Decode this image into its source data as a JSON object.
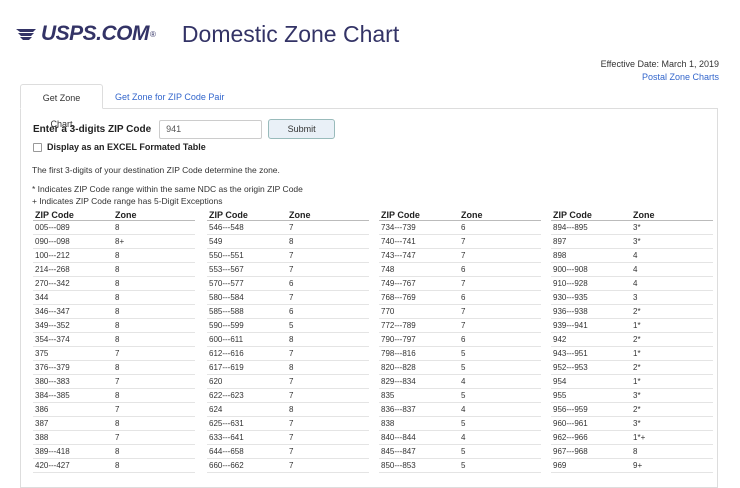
{
  "header": {
    "logo_text": "USPS.COM",
    "logo_mark": "®",
    "title": "Domestic Zone Chart",
    "brand_color": "#333366"
  },
  "effective_date": "Effective Date: March 1, 2019",
  "postal_zone_charts_link": "Postal Zone Charts",
  "tabs": [
    {
      "label": "Get Zone Chart",
      "active": true
    },
    {
      "label": "Get Zone for ZIP Code Pair",
      "active": false
    }
  ],
  "form": {
    "zip_label": "Enter a 3-digits ZIP Code",
    "zip_value": "941",
    "submit_label": "Submit",
    "excel_checkbox_label": "Display as an EXCEL Formated Table",
    "excel_checked": false
  },
  "info": {
    "line1": "The first 3-digits of your destination ZIP Code determine the zone.",
    "line2": "* Indicates ZIP Code range within the same NDC as the origin ZIP Code",
    "line3": "+ Indicates ZIP Code range has 5-Digit Exceptions"
  },
  "table_headers": {
    "zip": "ZIP Code",
    "zone": "Zone"
  },
  "columns": [
    [
      [
        "005---089",
        "8"
      ],
      [
        "090---098",
        "8+"
      ],
      [
        "100---212",
        "8"
      ],
      [
        "214---268",
        "8"
      ],
      [
        "270---342",
        "8"
      ],
      [
        "344",
        "8"
      ],
      [
        "346---347",
        "8"
      ],
      [
        "349---352",
        "8"
      ],
      [
        "354---374",
        "8"
      ],
      [
        "375",
        "7"
      ],
      [
        "376---379",
        "8"
      ],
      [
        "380---383",
        "7"
      ],
      [
        "384---385",
        "8"
      ],
      [
        "386",
        "7"
      ],
      [
        "387",
        "8"
      ],
      [
        "388",
        "7"
      ],
      [
        "389---418",
        "8"
      ],
      [
        "420---427",
        "8"
      ]
    ],
    [
      [
        "546---548",
        "7"
      ],
      [
        "549",
        "8"
      ],
      [
        "550---551",
        "7"
      ],
      [
        "553---567",
        "7"
      ],
      [
        "570---577",
        "6"
      ],
      [
        "580---584",
        "7"
      ],
      [
        "585---588",
        "6"
      ],
      [
        "590---599",
        "5"
      ],
      [
        "600---611",
        "8"
      ],
      [
        "612---616",
        "7"
      ],
      [
        "617---619",
        "8"
      ],
      [
        "620",
        "7"
      ],
      [
        "622---623",
        "7"
      ],
      [
        "624",
        "8"
      ],
      [
        "625---631",
        "7"
      ],
      [
        "633---641",
        "7"
      ],
      [
        "644---658",
        "7"
      ],
      [
        "660---662",
        "7"
      ]
    ],
    [
      [
        "734---739",
        "6"
      ],
      [
        "740---741",
        "7"
      ],
      [
        "743---747",
        "7"
      ],
      [
        "748",
        "6"
      ],
      [
        "749---767",
        "7"
      ],
      [
        "768---769",
        "6"
      ],
      [
        "770",
        "7"
      ],
      [
        "772---789",
        "7"
      ],
      [
        "790---797",
        "6"
      ],
      [
        "798---816",
        "5"
      ],
      [
        "820---828",
        "5"
      ],
      [
        "829---834",
        "4"
      ],
      [
        "835",
        "5"
      ],
      [
        "836---837",
        "4"
      ],
      [
        "838",
        "5"
      ],
      [
        "840---844",
        "4"
      ],
      [
        "845---847",
        "5"
      ],
      [
        "850---853",
        "5"
      ]
    ],
    [
      [
        "894---895",
        "3*"
      ],
      [
        "897",
        "3*"
      ],
      [
        "898",
        "4"
      ],
      [
        "900---908",
        "4"
      ],
      [
        "910---928",
        "4"
      ],
      [
        "930---935",
        "3"
      ],
      [
        "936---938",
        "2*"
      ],
      [
        "939---941",
        "1*"
      ],
      [
        "942",
        "2*"
      ],
      [
        "943---951",
        "1*"
      ],
      [
        "952---953",
        "2*"
      ],
      [
        "954",
        "1*"
      ],
      [
        "955",
        "3*"
      ],
      [
        "956---959",
        "2*"
      ],
      [
        "960---961",
        "3*"
      ],
      [
        "962---966",
        "1*+"
      ],
      [
        "967---968",
        "8"
      ],
      [
        "969",
        "9+"
      ]
    ]
  ]
}
